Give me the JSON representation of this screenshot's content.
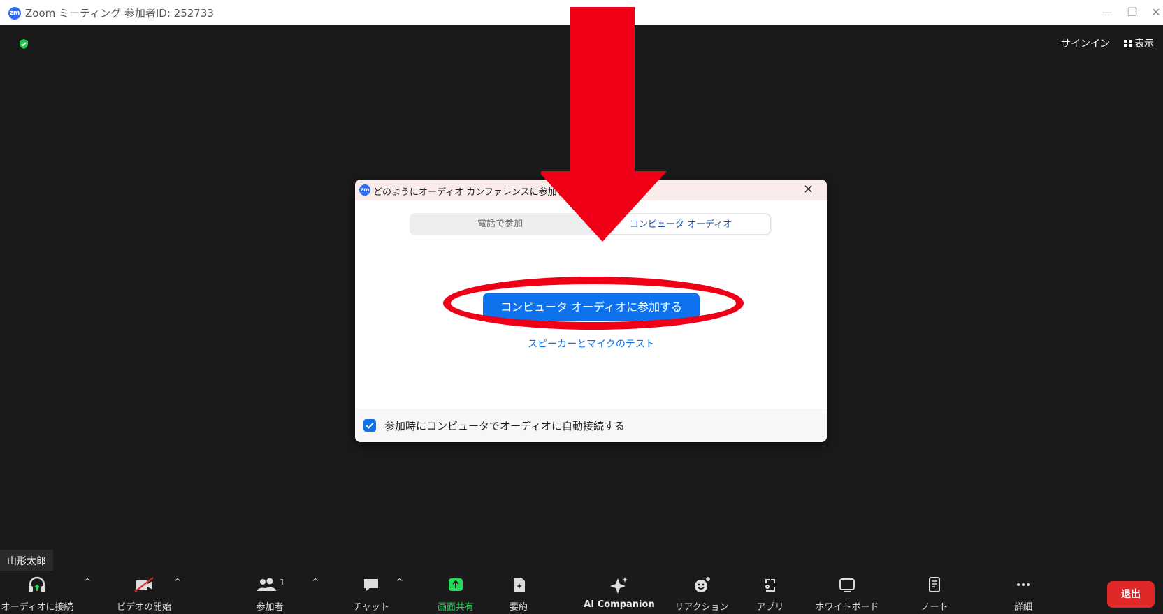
{
  "titlebar": {
    "logo": "zm",
    "title": "Zoom ミーティング 参加者ID: 252733",
    "minimize": "—",
    "restore": "❐",
    "close": "✕"
  },
  "top_right": {
    "signin_label": "サインイン",
    "view_label": "表示"
  },
  "dialog": {
    "logo": "zm",
    "title": "どのようにオーディオ カンファレンスに参加しますか?",
    "close": "✕",
    "tabs": [
      {
        "label": "電話で参加",
        "selected": false
      },
      {
        "label": "コンピュータ オーディオ",
        "selected": true
      }
    ],
    "join_button_label": "コンピュータ オーディオに参加する",
    "test_link_label": "スピーカーとマイクのテスト",
    "auto_connect_label": "参加時にコンピュータでオーディオに自動接続する",
    "auto_connect_checked": true
  },
  "annotation": {
    "color": "#f00016"
  },
  "self_view": {
    "name": "山形太郎"
  },
  "toolbar": {
    "items": [
      {
        "label": "オーディオに接続",
        "icon": "headphones-icon"
      },
      {
        "label": "ビデオの開始",
        "icon": "video-off-icon"
      },
      {
        "label": "参加者",
        "icon": "participants-icon",
        "count": "1"
      },
      {
        "label": "チャット",
        "icon": "chat-icon"
      },
      {
        "label": "画面共有",
        "icon": "share-screen-icon",
        "color": "#23d959"
      },
      {
        "label": "要約",
        "icon": "summary-icon"
      },
      {
        "label": "AI Companion",
        "icon": "ai-companion-icon"
      },
      {
        "label": "リアクション",
        "icon": "reaction-icon"
      },
      {
        "label": "アプリ",
        "icon": "apps-icon"
      },
      {
        "label": "ホワイトボード",
        "icon": "whiteboard-icon"
      },
      {
        "label": "ノート",
        "icon": "notes-icon"
      },
      {
        "label": "詳細",
        "icon": "more-icon"
      }
    ],
    "caret": "^",
    "leave_label": "退出",
    "leave_color": "#e02828"
  }
}
